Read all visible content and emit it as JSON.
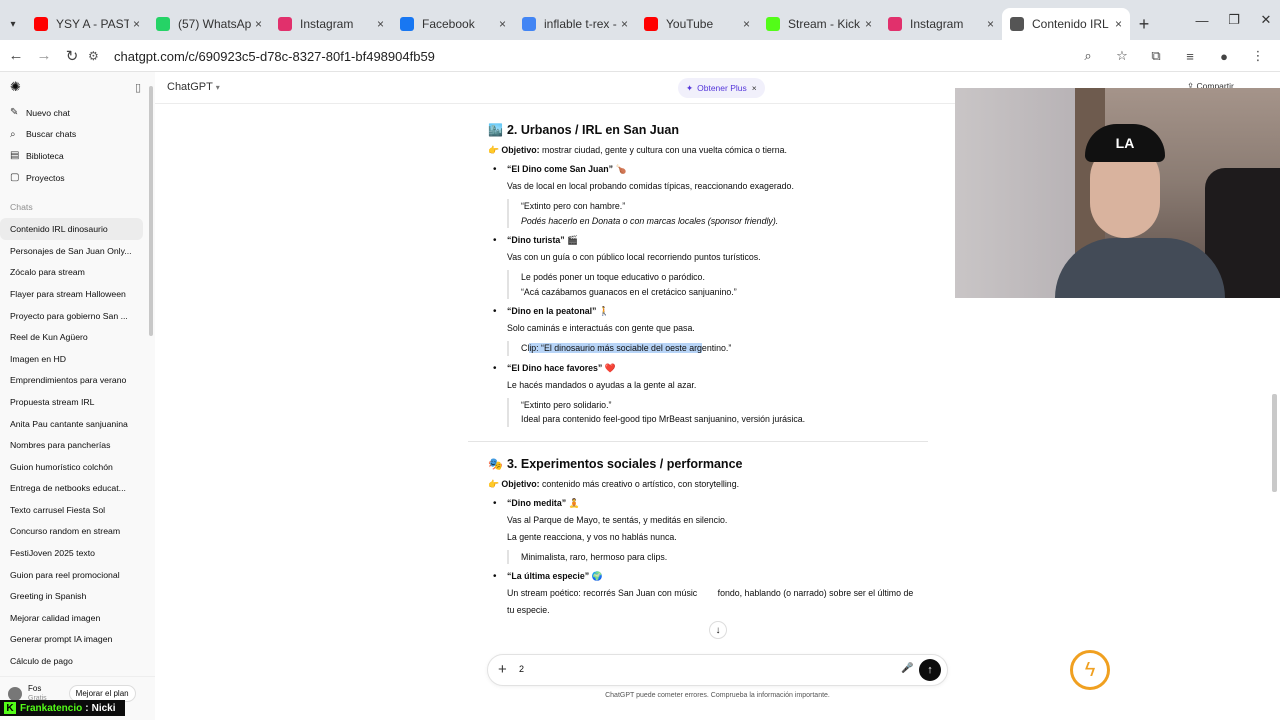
{
  "browser": {
    "tabs": [
      {
        "label": "YSY A - PASTEL C",
        "icon": "youtube-icon",
        "color": "#ff0000",
        "close": "×"
      },
      {
        "label": "(57) WhatsApp",
        "icon": "whatsapp-icon",
        "color": "#25d366",
        "close": "×"
      },
      {
        "label": "Instagram",
        "icon": "instagram-icon",
        "color": "#e1306c",
        "close": "×"
      },
      {
        "label": "Facebook",
        "icon": "facebook-icon",
        "color": "#1877f2",
        "close": "×"
      },
      {
        "label": "inflable t-rex - Buscar",
        "icon": "google-icon",
        "color": "#4285f4",
        "close": "×"
      },
      {
        "label": "YouTube",
        "icon": "youtube-icon",
        "color": "#ff0000",
        "close": "×"
      },
      {
        "label": "Stream - Kick Dashbo",
        "icon": "kick-icon",
        "color": "#53fc18",
        "close": "×"
      },
      {
        "label": "Instagram",
        "icon": "instagram-icon",
        "color": "#e1306c",
        "close": "×"
      },
      {
        "label": "Contenido IRL dinosa",
        "icon": "chatgpt-icon",
        "color": "#555555",
        "close": "×"
      }
    ],
    "new_tab": "+",
    "url": "chatgpt.com/c/690923c5-d78c-8327-80f1-bf498904fb59"
  },
  "sidebar": {
    "nav": [
      {
        "label": "Nuevo chat",
        "icon": "✎"
      },
      {
        "label": "Buscar chats",
        "icon": "⌕"
      },
      {
        "label": "Biblioteca",
        "icon": "▤"
      },
      {
        "label": "Proyectos",
        "icon": "▢"
      }
    ],
    "section_label": "Chats",
    "chats": [
      "Contenido IRL dinosaurio",
      "Personajes de San Juan Only...",
      "Zócalo para stream",
      "Flayer para stream Halloween",
      "Proyecto para gobierno San ...",
      "Reel de Kun Agüero",
      "Imagen en HD",
      "Emprendimientos para verano",
      "Propuesta stream IRL",
      "Anita Pau cantante sanjuanina",
      "Nombres para pancherías",
      "Guion humorístico colchón",
      "Entrega de netbooks educat...",
      "Texto carrusel Fiesta Sol",
      "Concurso random en stream",
      "FestiJoven 2025 texto",
      "Guion para reel promocional",
      "Greeting in Spanish",
      "Mejorar calidad imagen",
      "Generar prompt IA imagen",
      "Cálculo de pago"
    ],
    "user": {
      "name": "Fos",
      "plan": "Gratis",
      "upgrade": "Mejorar el plan"
    }
  },
  "header": {
    "model": "ChatGPT",
    "plus_label": "Obtener Plus",
    "plus_close": "×",
    "share": "Compartir"
  },
  "content": {
    "section2": {
      "emoji": "🏙️",
      "title": "2. Urbanos / IRL en San Juan",
      "obj_emoji": "👉",
      "obj_label": "Objetivo:",
      "obj_text": " mostrar ciudad, gente y cultura con una vuelta cómica o tierna.",
      "items": [
        {
          "title": "“El Dino come San Juan”",
          "emoji": "🍗",
          "desc": "Vas de local en local probando comidas típicas, reaccionando exagerado.",
          "quote1": "“Extinto pero con hambre.”",
          "quote2": "Podés hacerlo en Donata o con marcas locales (sponsor friendly)."
        },
        {
          "title": "“Dino turista”",
          "emoji": "🎬",
          "desc": "Vas con un guía o con público local recorriendo puntos turísticos.",
          "quote1": "Le podés poner un toque educativo o paródico.",
          "quote2": "“Acá cazábamos guanacos en el cretácico sanjuanino.”"
        },
        {
          "title": "“Dino en la peatonal”",
          "emoji": "🚶",
          "desc": "Solo caminás e interactuás con gente que pasa.",
          "quote_pre": "Cl",
          "quote_hl": "ip: “El dinosaurio más sociable del oeste arg",
          "quote_post": "entino.”"
        },
        {
          "title": "“El Dino hace favores”",
          "emoji": "❤️",
          "desc": "Le hacés mandados o ayudas a la gente al azar.",
          "quote1": "“Extinto pero solidario.”",
          "quote2": "Ideal para contenido feel-good tipo MrBeast sanjuanino, versión jurásica."
        }
      ]
    },
    "section3": {
      "emoji": "🎭",
      "title": "3. Experimentos sociales / performance",
      "obj_emoji": "👉",
      "obj_label": "Objetivo:",
      "obj_text": " contenido más creativo o artístico, con storytelling.",
      "items": [
        {
          "title": "“Dino medita”",
          "emoji": "🧘",
          "desc1": "Vas al Parque de Mayo, te sentás, y meditás en silencio.",
          "desc2": "La gente reacciona, y vos no hablás nunca.",
          "quote1": "Minimalista, raro, hermoso para clips."
        },
        {
          "title": "“La última especie”",
          "emoji": "🌍",
          "desc_a": "Un stream poético: recorrés San Juan con músic",
          "desc_b": " fondo, hablando (o narrado) sobre ser el último de",
          "desc_c": "tu especie."
        }
      ]
    }
  },
  "composer": {
    "value": "2",
    "plus": "+",
    "mic": "🎤",
    "send": "↑",
    "scroll_down": "↓"
  },
  "disclaimer": "ChatGPT puede cometer errores. Comprueba la información importante.",
  "stream_overlay": {
    "user": "Frankatencio",
    "name": "Nicki",
    "kick_letter": "K",
    "colon": ":"
  }
}
